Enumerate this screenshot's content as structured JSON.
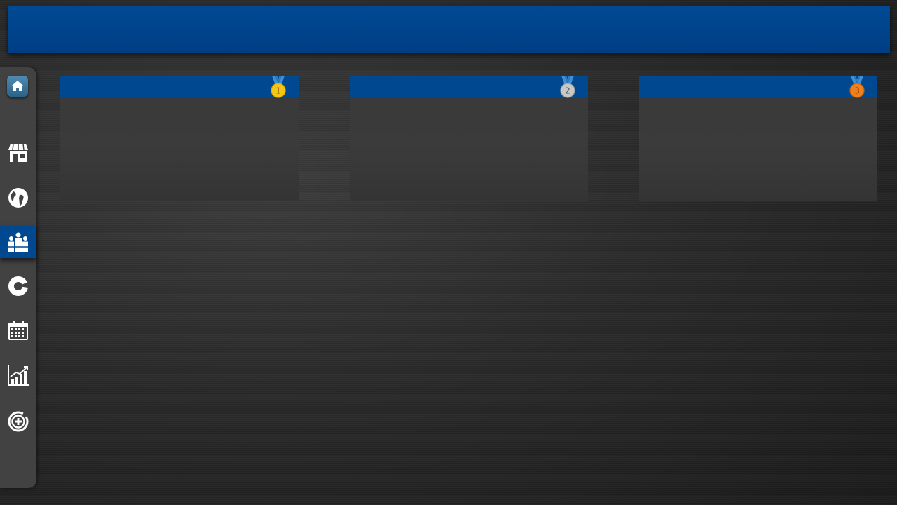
{
  "header": {
    "title": ""
  },
  "sidebar": {
    "home": {
      "icon": "home-icon"
    },
    "items": [
      {
        "icon": "store-icon",
        "active": false
      },
      {
        "icon": "globe-icon",
        "active": false
      },
      {
        "icon": "group-icon",
        "active": true
      },
      {
        "icon": "pie-chart-icon",
        "active": false
      },
      {
        "icon": "calendar-icon",
        "active": false
      },
      {
        "icon": "bar-chart-icon",
        "active": false
      },
      {
        "icon": "add-circle-icon",
        "active": false
      }
    ]
  },
  "podium": [
    {
      "rank": "1",
      "medal": "gold-medal-icon",
      "title": ""
    },
    {
      "rank": "2",
      "medal": "silver-medal-icon",
      "title": ""
    },
    {
      "rank": "3",
      "medal": "bronze-medal-icon",
      "title": ""
    }
  ],
  "colors": {
    "accent": "#004990",
    "banner": "#00438c",
    "sidebar": "#424242",
    "card": "#393939",
    "gold": "#f5c518",
    "silver": "#c8c8c8",
    "bronze": "#f0801e",
    "ribbon": "#3f8fd6"
  }
}
